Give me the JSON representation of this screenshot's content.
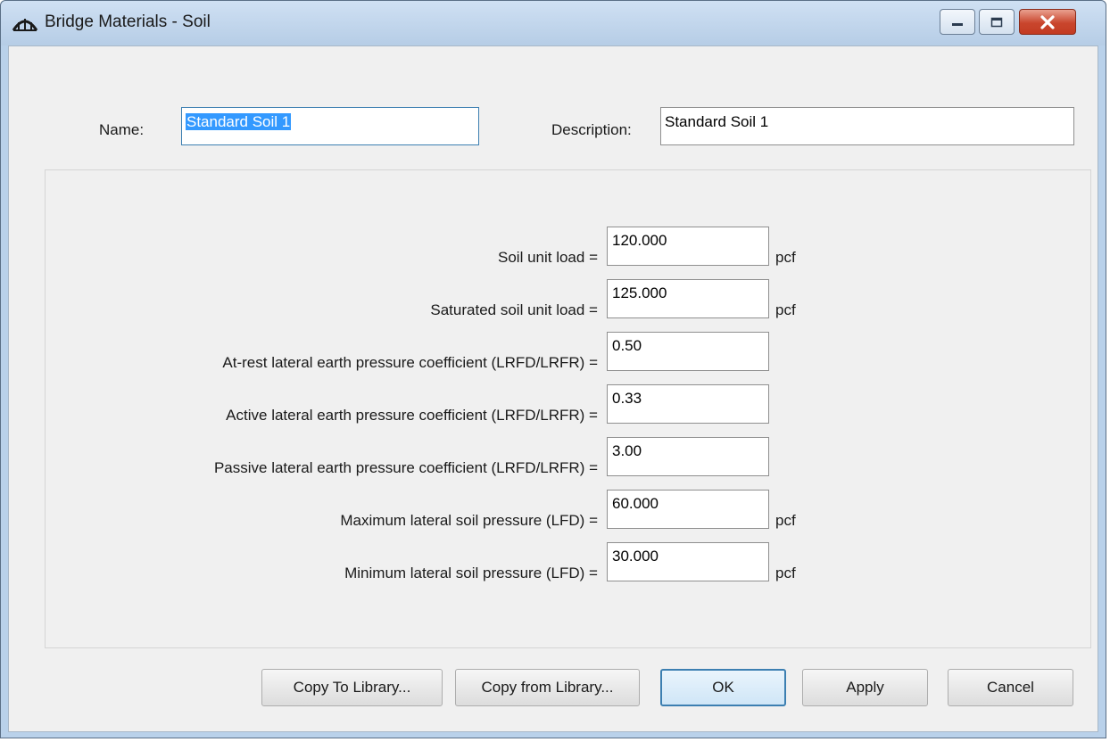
{
  "window": {
    "title": "Bridge Materials - Soil"
  },
  "header": {
    "name_label": "Name:",
    "name_value": "Standard Soil 1",
    "description_label": "Description:",
    "description_value": "Standard Soil 1"
  },
  "fields": [
    {
      "label": "Soil unit load =",
      "value": "120.000",
      "unit": "pcf"
    },
    {
      "label": "Saturated soil unit load =",
      "value": "125.000",
      "unit": "pcf"
    },
    {
      "label": "At-rest lateral earth pressure coefficient (LRFD/LRFR) =",
      "value": "0.50",
      "unit": ""
    },
    {
      "label": "Active lateral earth pressure coefficient (LRFD/LRFR) =",
      "value": "0.33",
      "unit": ""
    },
    {
      "label": "Passive lateral earth pressure coefficient (LRFD/LRFR) =",
      "value": "3.00",
      "unit": ""
    },
    {
      "label": "Maximum lateral soil pressure (LFD) =",
      "value": "60.000",
      "unit": "pcf"
    },
    {
      "label": "Minimum lateral soil pressure (LFD) =",
      "value": "30.000",
      "unit": "pcf"
    }
  ],
  "buttons": {
    "copy_to_library": "Copy To Library...",
    "copy_from_library": "Copy from Library...",
    "ok": "OK",
    "apply": "Apply",
    "cancel": "Cancel"
  },
  "icons": {
    "app": "bridge-icon",
    "minimize": "minimize-icon",
    "maximize": "maximize-icon",
    "close": "close-icon"
  },
  "colors": {
    "selection": "#3399ff",
    "focus_border": "#3c7fb1",
    "close_button": "#c9462d"
  }
}
